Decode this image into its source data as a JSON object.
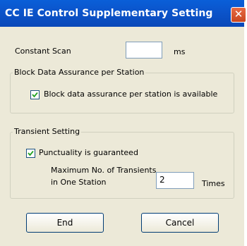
{
  "window": {
    "title": "CC IE Control Supplementary Setting",
    "close_icon": "close-icon"
  },
  "constant_scan": {
    "label": "Constant Scan",
    "value": "",
    "unit": "ms"
  },
  "block_group": {
    "title": "Block Data Assurance per Station",
    "checkbox_label": "Block data assurance per station is available",
    "checked": true
  },
  "transient_group": {
    "title": "Transient Setting",
    "checkbox_label": "Punctuality is guaranteed",
    "checked": true,
    "max_label_line1": "Maximum No. of Transients",
    "max_label_line2": "in One Station",
    "max_value": "2",
    "unit": "Times"
  },
  "buttons": {
    "end": "End",
    "cancel": "Cancel"
  }
}
